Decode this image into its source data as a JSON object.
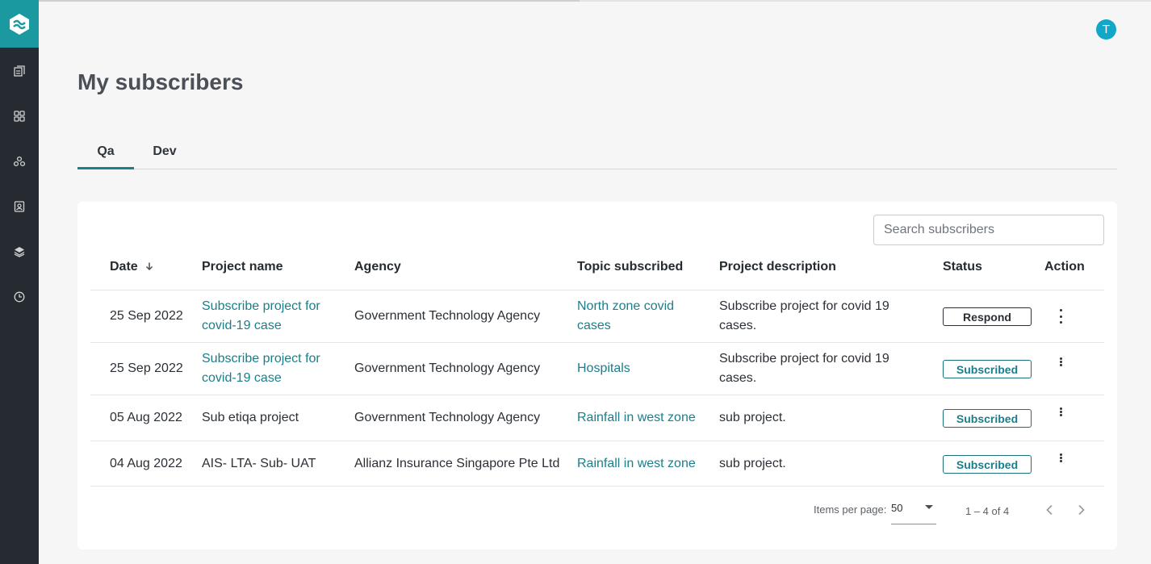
{
  "user": {
    "avatar_initial": "T"
  },
  "page": {
    "title": "My subscribers"
  },
  "tabs": [
    {
      "label": "Qa",
      "active": true
    },
    {
      "label": "Dev",
      "active": false
    }
  ],
  "search": {
    "placeholder": "Search subscribers"
  },
  "table": {
    "headers": {
      "date": "Date",
      "project_name": "Project name",
      "agency": "Agency",
      "topic": "Topic subscribed",
      "description": "Project description",
      "status": "Status",
      "action": "Action"
    },
    "rows": [
      {
        "date": "25 Sep 2022",
        "project_name_l1": "Subscribe project for",
        "project_name_l2": "covid-19 case",
        "agency": "Government Technology Agency",
        "topic_l1": "North zone covid",
        "topic_l2": "cases",
        "desc_l1": "Subscribe project for covid 19",
        "desc_l2": "cases.",
        "status": "Respond"
      },
      {
        "date": "25 Sep 2022",
        "project_name_l1": "Subscribe project for",
        "project_name_l2": "covid-19 case",
        "agency": "Government Technology Agency",
        "topic_l1": "Hospitals",
        "desc_l1": "Subscribe project for covid 19",
        "desc_l2": "cases.",
        "status": "Subscribed"
      },
      {
        "date": "05 Aug 2022",
        "project_name_l1": "Sub etiqa project",
        "agency": "Government Technology Agency",
        "topic_l1": "Rainfall in west zone",
        "desc_l1": "sub project.",
        "status": "Subscribed"
      },
      {
        "date": "04 Aug 2022",
        "project_name_l1": "AIS- LTA- Sub- UAT",
        "agency": "Allianz Insurance Singapore Pte Ltd",
        "topic_l1": "Rainfall in west zone",
        "desc_l1": "sub project.",
        "status": "Subscribed"
      }
    ]
  },
  "pagination": {
    "items_per_page_label": "Items per page:",
    "items_per_page": "50",
    "range": "1 – 4 of 4"
  },
  "colors": {
    "accent": "#1a9aa0",
    "link": "#1b7e8a",
    "sidebar": "#262b32",
    "avatar": "#12a7c8"
  },
  "icons": {
    "sidebar": [
      "logo-icon",
      "documents-icon",
      "grid-icon",
      "network-icon",
      "contacts-icon",
      "layers-icon",
      "clock-icon"
    ]
  }
}
